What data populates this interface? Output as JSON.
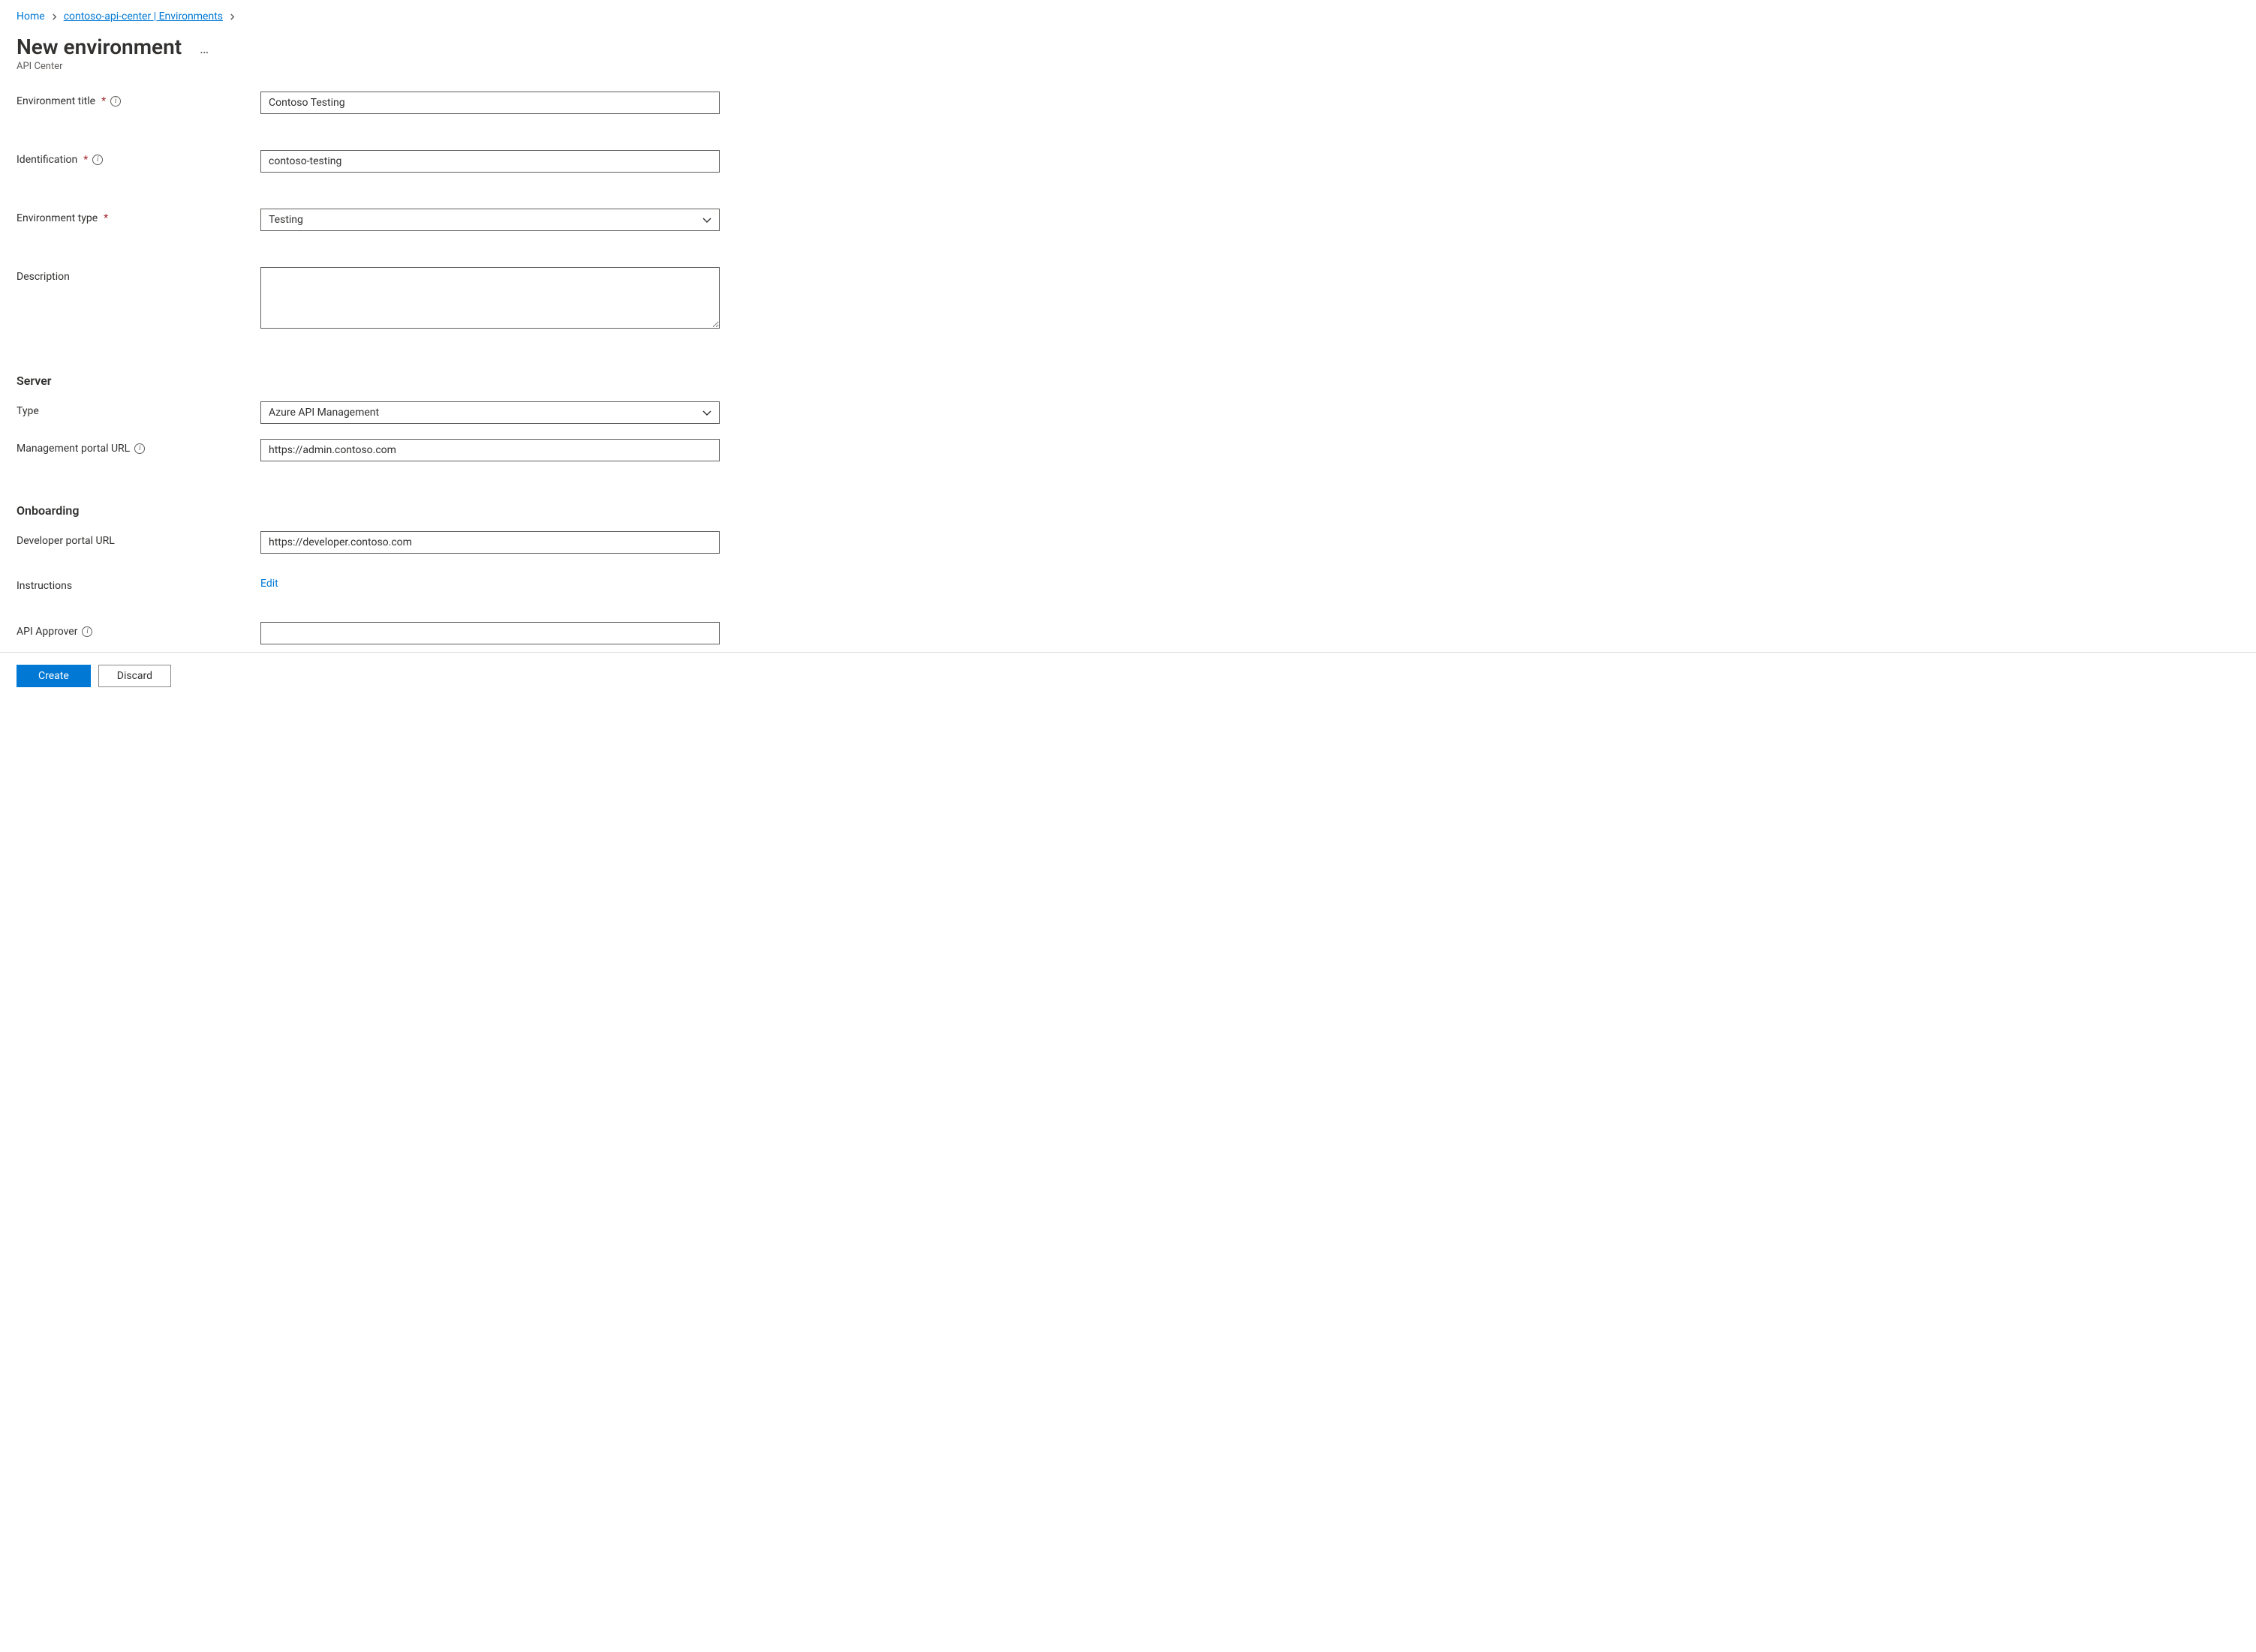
{
  "breadcrumb": {
    "home": "Home",
    "resource": "contoso-api-center | Environments"
  },
  "header": {
    "title": "New environment",
    "subtitle": "API Center"
  },
  "labels": {
    "env_title": "Environment title",
    "identification": "Identification",
    "env_type": "Environment type",
    "description": "Description",
    "server_heading": "Server",
    "server_type": "Type",
    "mgmt_url": "Management portal URL",
    "onboarding_heading": "Onboarding",
    "dev_url": "Developer portal URL",
    "instructions": "Instructions",
    "api_approver": "API Approver"
  },
  "values": {
    "env_title": "Contoso Testing",
    "identification": "contoso-testing",
    "env_type": "Testing",
    "description": "",
    "server_type": "Azure API Management",
    "mgmt_url": "https://admin.contoso.com",
    "dev_url": "https://developer.contoso.com",
    "api_approver": ""
  },
  "actions": {
    "edit": "Edit",
    "create": "Create",
    "discard": "Discard"
  }
}
